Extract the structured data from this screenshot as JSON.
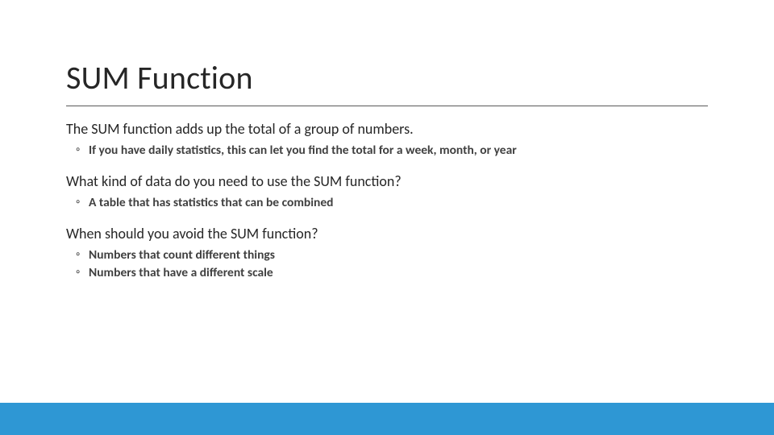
{
  "title": "SUM Function",
  "sections": [
    {
      "lead": "The SUM function adds up the total of a group of numbers.",
      "bullets": [
        "If you have daily statistics, this can let you find the total for a week, month, or year"
      ]
    },
    {
      "lead": "What kind of data do you need to use the SUM function?",
      "bullets": [
        "A table that has statistics that can be combined"
      ]
    },
    {
      "lead": "When should you avoid the SUM function?",
      "bullets": [
        "Numbers that count different things",
        "Numbers that have a different scale"
      ]
    }
  ],
  "accent_color": "#2E97D4"
}
